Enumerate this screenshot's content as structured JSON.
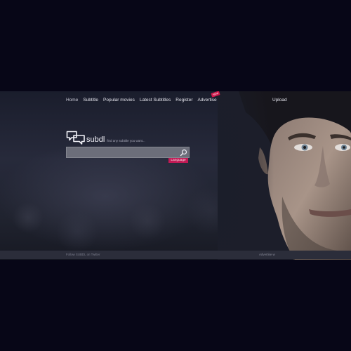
{
  "nav": {
    "items": [
      {
        "label": "Home",
        "active": true
      },
      {
        "label": "Subtitle"
      },
      {
        "label": "Popular movies"
      },
      {
        "label": "Latest Subtitles"
      },
      {
        "label": "Register"
      },
      {
        "label": "Advertise",
        "badge": "NEW"
      }
    ],
    "upload_label": "Upload"
  },
  "logo": {
    "text": "subdl",
    "tagline": "find any subtitle you want..."
  },
  "search": {
    "value": "",
    "placeholder": "",
    "language_label": "Language",
    "icon": "search-icon"
  },
  "footer": {
    "follow_text": "Follow SUBDL on Twitter",
    "advertise_text": "Advertise w"
  },
  "colors": {
    "background": "#070617",
    "accent": "#c11a55",
    "badge": "#d0164a"
  }
}
